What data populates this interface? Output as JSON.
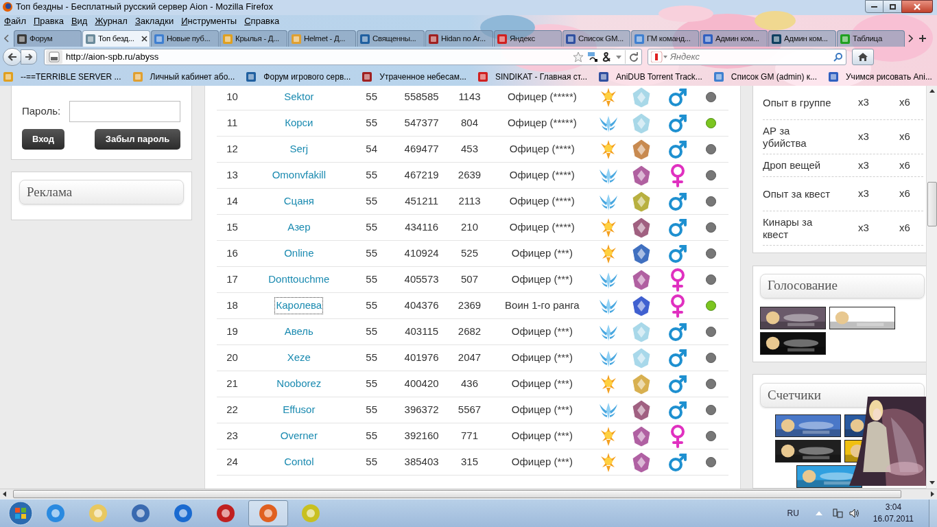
{
  "window": {
    "title": "Топ бездны - Бесплатный русский сервер Aion - Mozilla Firefox"
  },
  "menu": [
    "Файл",
    "Правка",
    "Вид",
    "Журнал",
    "Закладки",
    "Инструменты",
    "Справка"
  ],
  "tabs": [
    {
      "label": "Форум",
      "selected": false
    },
    {
      "label": "Топ безд...",
      "selected": true
    },
    {
      "label": "Новые пуб...",
      "selected": false
    },
    {
      "label": "Крылья - Д...",
      "selected": false
    },
    {
      "label": "Helmet - Д...",
      "selected": false
    },
    {
      "label": "Священны...",
      "selected": false
    },
    {
      "label": "Hidan no Ar...",
      "selected": false
    },
    {
      "label": "Яндекс",
      "selected": false
    },
    {
      "label": "Список GM...",
      "selected": false
    },
    {
      "label": "ГМ команд...",
      "selected": false
    },
    {
      "label": "Админ ком...",
      "selected": false
    },
    {
      "label": "Админ ком...",
      "selected": false
    },
    {
      "label": "Таблица",
      "selected": false
    }
  ],
  "address": {
    "url": "http://aion-spb.ru/abyss"
  },
  "search": {
    "placeholder": "Яндекс"
  },
  "bookmarks": [
    "--==TERRIBLE SERVER ...",
    "Личный кабинет або...",
    "Форум игрового серв...",
    "Утраченное небесам...",
    "SINDIKAT - Главная ст...",
    "AniDUB Torrent Track...",
    "Список GM (admin) к...",
    "Учимся рисовать Ani..."
  ],
  "login": {
    "password_label": "Пароль:",
    "buttons": [
      "Вход",
      "Забыл пароль"
    ]
  },
  "ads_panel": {
    "title": "Реклама"
  },
  "players": [
    {
      "rank": "10",
      "name": "Sektor",
      "level": "55",
      "ap": "558585",
      "kills": "1143",
      "title": "Офицер (*****)",
      "race": {
        "kind": "sun"
      },
      "class_emblem": {
        "color": "#a8d8e8"
      },
      "gender": {
        "kind": "male"
      },
      "online": false,
      "selected": false
    },
    {
      "rank": "11",
      "name": "Корси",
      "level": "55",
      "ap": "547377",
      "kills": "804",
      "title": "Офицер (*****)",
      "race": {
        "kind": "wings"
      },
      "class_emblem": {
        "color": "#a8d8e8"
      },
      "gender": {
        "kind": "male"
      },
      "online": true,
      "selected": false
    },
    {
      "rank": "12",
      "name": "Serj",
      "level": "54",
      "ap": "469477",
      "kills": "453",
      "title": "Офицер (****)",
      "race": {
        "kind": "sun"
      },
      "class_emblem": {
        "color": "#c88a50"
      },
      "gender": {
        "kind": "male"
      },
      "online": false,
      "selected": false
    },
    {
      "rank": "13",
      "name": "Omonvfakill",
      "level": "55",
      "ap": "467219",
      "kills": "2639",
      "title": "Офицер (****)",
      "race": {
        "kind": "wings"
      },
      "class_emblem": {
        "color": "#b060a0"
      },
      "gender": {
        "kind": "female"
      },
      "online": false,
      "selected": false
    },
    {
      "rank": "14",
      "name": "Сцаня",
      "level": "55",
      "ap": "451211",
      "kills": "2113",
      "title": "Офицер (****)",
      "race": {
        "kind": "wings"
      },
      "class_emblem": {
        "color": "#b8b040"
      },
      "gender": {
        "kind": "male"
      },
      "online": false,
      "selected": false
    },
    {
      "rank": "15",
      "name": "Азер",
      "level": "55",
      "ap": "434116",
      "kills": "210",
      "title": "Офицер (****)",
      "race": {
        "kind": "sun"
      },
      "class_emblem": {
        "color": "#a06080"
      },
      "gender": {
        "kind": "male"
      },
      "online": false,
      "selected": false
    },
    {
      "rank": "16",
      "name": "Online",
      "level": "55",
      "ap": "410924",
      "kills": "525",
      "title": "Офицер (***)",
      "race": {
        "kind": "sun"
      },
      "class_emblem": {
        "color": "#4070c0"
      },
      "gender": {
        "kind": "male"
      },
      "online": false,
      "selected": false
    },
    {
      "rank": "17",
      "name": "Donttouchme",
      "level": "55",
      "ap": "405573",
      "kills": "507",
      "title": "Офицер (***)",
      "race": {
        "kind": "wings"
      },
      "class_emblem": {
        "color": "#b060a1"
      },
      "gender": {
        "kind": "female"
      },
      "online": false,
      "selected": false
    },
    {
      "rank": "18",
      "name": "Каролева",
      "level": "55",
      "ap": "404376",
      "kills": "2369",
      "title": "Воин 1-го ранга",
      "race": {
        "kind": "wings"
      },
      "class_emblem": {
        "color": "#4060d0"
      },
      "gender": {
        "kind": "female"
      },
      "online": true,
      "selected": true
    },
    {
      "rank": "19",
      "name": "Авель",
      "level": "55",
      "ap": "403115",
      "kills": "2682",
      "title": "Офицер (***)",
      "race": {
        "kind": "wings"
      },
      "class_emblem": {
        "color": "#a8d8e9"
      },
      "gender": {
        "kind": "male"
      },
      "online": false,
      "selected": false
    },
    {
      "rank": "20",
      "name": "Xeze",
      "level": "55",
      "ap": "401976",
      "kills": "2047",
      "title": "Офицер (***)",
      "race": {
        "kind": "wings"
      },
      "class_emblem": {
        "color": "#a8d8ea"
      },
      "gender": {
        "kind": "male"
      },
      "online": false,
      "selected": false
    },
    {
      "rank": "21",
      "name": "Nooborez",
      "level": "55",
      "ap": "400420",
      "kills": "436",
      "title": "Офицер (***)",
      "race": {
        "kind": "sun"
      },
      "class_emblem": {
        "color": "#d8b050"
      },
      "gender": {
        "kind": "male"
      },
      "online": false,
      "selected": false
    },
    {
      "rank": "22",
      "name": "Effusor",
      "level": "55",
      "ap": "396372",
      "kills": "5567",
      "title": "Офицер (***)",
      "race": {
        "kind": "wings"
      },
      "class_emblem": {
        "color": "#a06081"
      },
      "gender": {
        "kind": "male"
      },
      "online": false,
      "selected": false
    },
    {
      "rank": "23",
      "name": "Overner",
      "level": "55",
      "ap": "392160",
      "kills": "771",
      "title": "Офицер (***)",
      "race": {
        "kind": "sun"
      },
      "class_emblem": {
        "color": "#b060a2"
      },
      "gender": {
        "kind": "female"
      },
      "online": false,
      "selected": false
    },
    {
      "rank": "24",
      "name": "Contol",
      "level": "55",
      "ap": "385403",
      "kills": "315",
      "title": "Офицер (***)",
      "race": {
        "kind": "sun"
      },
      "class_emblem": {
        "color": "#b060a3"
      },
      "gender": {
        "kind": "male"
      },
      "online": false,
      "selected": false
    }
  ],
  "rates": [
    {
      "label": "Опыт в группе",
      "col_1": "x3",
      "col_2": "x6"
    },
    {
      "label": "АР за убийства",
      "col_1": "x3",
      "col_2": "x6"
    },
    {
      "label": "Дроп вещей",
      "col_1": "x3",
      "col_2": "x6"
    },
    {
      "label": "Опыт за квест",
      "col_1": "x3",
      "col_2": "x6"
    },
    {
      "label": "Кинары за квест",
      "col_1": "x3",
      "col_2": "x6"
    }
  ],
  "vote_panel": {
    "title": "Голосование"
  },
  "counters_panel": {
    "title": "Счетчики"
  },
  "taskbar": {
    "language": "RU",
    "time": "3:04",
    "date": "16.07.2011"
  }
}
